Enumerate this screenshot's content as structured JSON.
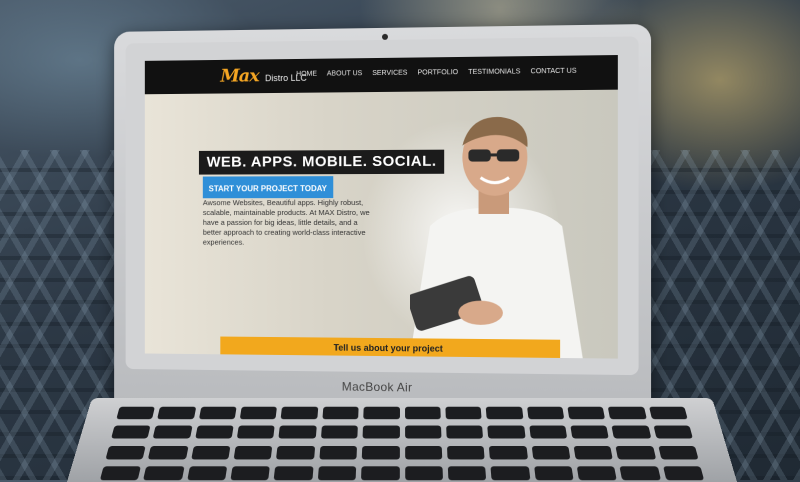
{
  "site": {
    "logo_max": "Max",
    "logo_sub": "Distro LLC",
    "nav": [
      "HOME",
      "ABOUT US",
      "SERVICES",
      "PORTFOLIO",
      "TESTIMONIALS",
      "CONTACT US"
    ],
    "headline": "WEB. APPS. MOBILE. SOCIAL.",
    "cta": "START YOUR PROJECT TODAY",
    "intro": "Awsome Websites, Beautiful apps. Highly robust, scalable, maintainable products. At MAX Distro, we have a passion for big ideas, little details, and a better approach to creating world-class interactive experiences.",
    "project_button": "Tell us about your project"
  },
  "device": {
    "label": "MacBook Air"
  },
  "colors": {
    "brand_orange": "#f5a623",
    "cta_blue": "#2f8fd8",
    "nav_bg": "#111111"
  }
}
